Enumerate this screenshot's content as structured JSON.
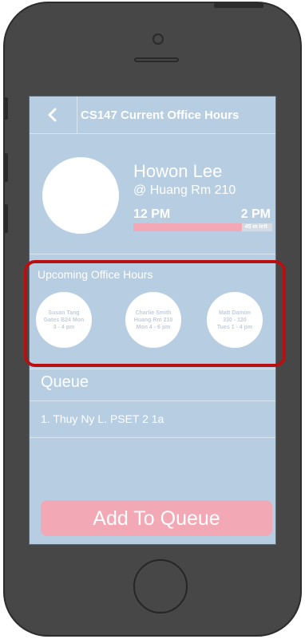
{
  "nav": {
    "back_icon": "chevron-left-icon",
    "title": "CS147 Current Office Hours"
  },
  "current": {
    "ta_name": "Howon Lee",
    "location": "@ Huang Rm 210",
    "start_time": "12 PM",
    "end_time": "2 PM",
    "time_left": "45 m left",
    "elapsed_fraction": 0.78
  },
  "upcoming": {
    "title": "Upcoming Office Hours",
    "items": [
      {
        "name": "Susan Tang",
        "location": "Gates B24 Mon",
        "time": "3 - 4 pm"
      },
      {
        "name": "Charlie Smith",
        "location": "Huang Rm 210",
        "time": "Mon 4 - 6 pm"
      },
      {
        "name": "Matt Damon",
        "location": "330 - 120",
        "time": "Tues 1 - 4 pm"
      }
    ]
  },
  "queue": {
    "title": "Queue",
    "items": [
      "1. Thuy Ny L. PSET 2 1a"
    ]
  },
  "add_button_label": "Add To Queue",
  "colors": {
    "screen_bg": "#b7cde2",
    "accent_pink": "#f3a9b5",
    "highlight_red": "#b80f10",
    "phone_body": "#474747"
  }
}
